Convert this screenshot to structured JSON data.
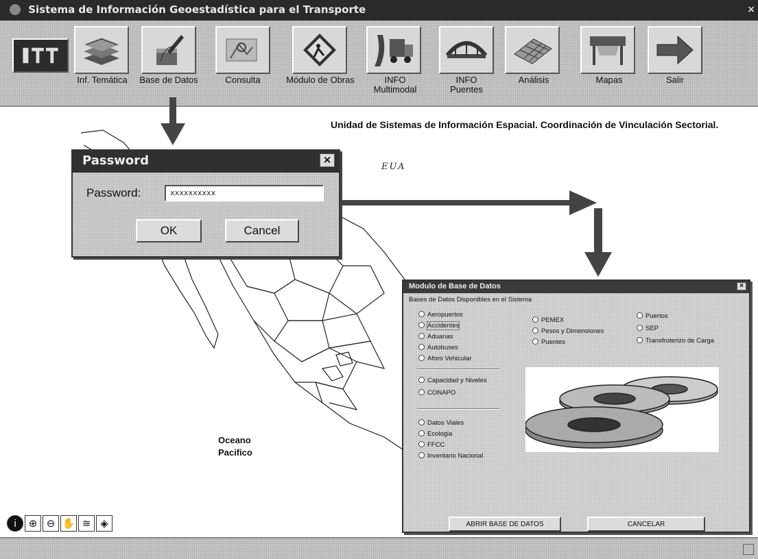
{
  "window": {
    "title": "Sistema de Información Geoestadística para el Transporte",
    "close_glyph": "×"
  },
  "toolbar": {
    "logo_icon": "imt-logo-icon",
    "buttons": [
      {
        "id": "inf-tematica",
        "label": "Inf. Temática",
        "icon": "stacked-layers-icon"
      },
      {
        "id": "base-datos",
        "label": "Base de Datos",
        "icon": "database-pen-icon"
      },
      {
        "id": "consulta",
        "label": "Consulta",
        "icon": "query-icon"
      },
      {
        "id": "modulo-obras",
        "label": "Módulo de Obras",
        "icon": "roadwork-sign-icon"
      },
      {
        "id": "info-multimodal",
        "label_line1": "INFO",
        "label_line2": "Multimodal",
        "icon": "truck-road-icon"
      },
      {
        "id": "info-puentes",
        "label_line1": "INFO",
        "label_line2": "Puentes",
        "icon": "bridge-icon"
      },
      {
        "id": "analisis",
        "label": "Análisis",
        "icon": "grid-map-icon"
      },
      {
        "id": "mapas",
        "label": "Mapas",
        "icon": "plotter-icon"
      },
      {
        "id": "salir",
        "label": "Salir",
        "icon": "exit-arrow-icon"
      }
    ]
  },
  "map": {
    "caption": "Unidad de Sistemas de Información Espacial. Coordinación de Vinculación Sectorial.",
    "country_label": "EUA",
    "ocean_line1": "Oceano",
    "ocean_line2": "Pacifico",
    "tools": [
      "info-icon",
      "zoom-in-icon",
      "zoom-out-icon",
      "pan-hand-icon",
      "layers-icon",
      "full-extent-icon"
    ]
  },
  "password_dialog": {
    "title": "Password",
    "close_glyph": "×",
    "label": "Password:",
    "value": "xxxxxxxxxx",
    "ok_label": "OK",
    "cancel_label": "Cancel"
  },
  "database_dialog": {
    "title": "Modulo de Base de Datos",
    "close_glyph": "×",
    "group_title": "Bases de Datos Disponibles en el Sistema",
    "options_col1_a": [
      "Aeropuertos",
      "Accidentes",
      "Aduanas",
      "Autobuses",
      "Aforo Vehicular"
    ],
    "options_col1_b": [
      "Capacidad y Niveles",
      "CONAPO"
    ],
    "options_col1_c": [
      "Datos Viales",
      "Ecologia",
      "FFCC",
      "Inventario Nacional"
    ],
    "options_col2": [
      "PEMEX",
      "Pesos y Dimensiones",
      "Puentes"
    ],
    "options_col3": [
      "Puertos",
      "SEP",
      "Transfroterizo de Carga"
    ],
    "focused_option": "Accidentes",
    "open_label": "ABRIR BASE DE DATOS",
    "cancel_label": "CANCELAR",
    "image_icon": "database-disks-icon"
  },
  "colors": {
    "toolbar_bg": "#c9c9c9",
    "title_bar": "#2a2a2a",
    "map_bg": "#ffffff",
    "arrow": "#444444"
  }
}
